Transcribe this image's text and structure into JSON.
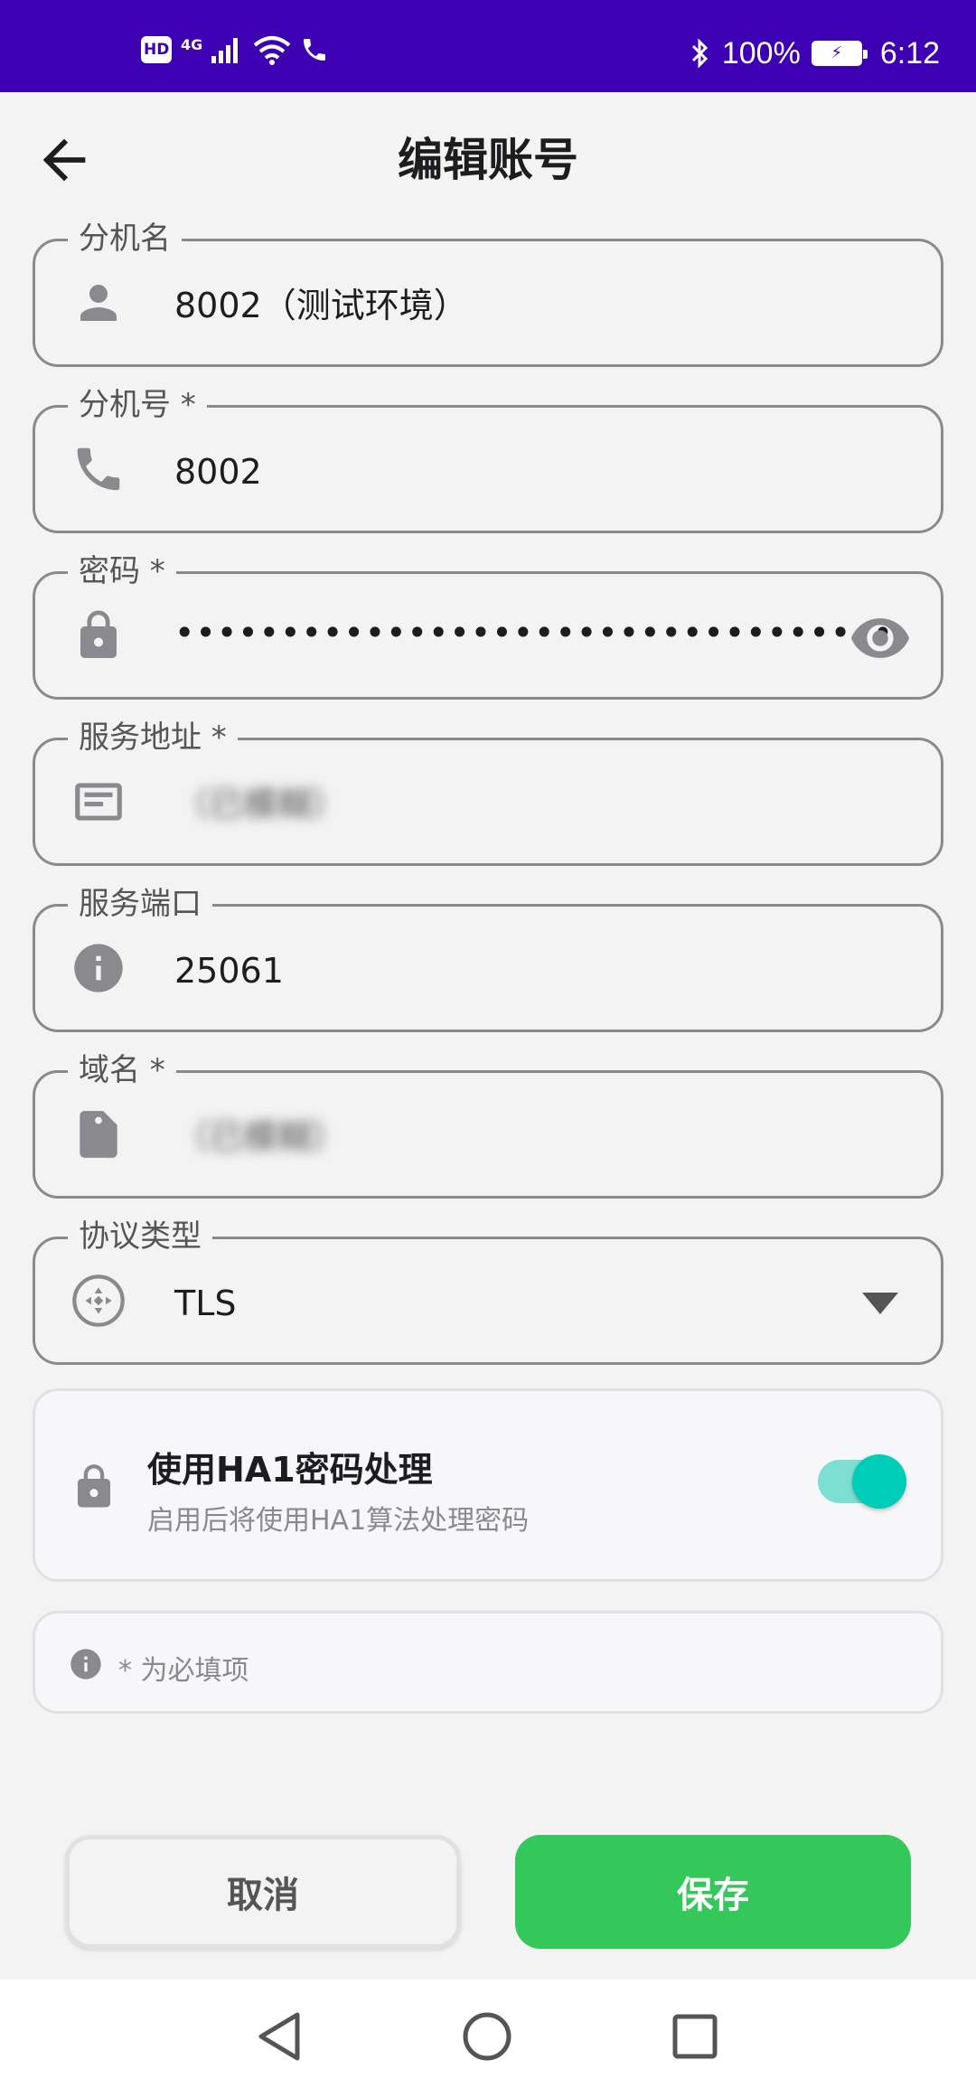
{
  "status_bar": {
    "hd": "HD",
    "network": "4G",
    "battery_percent": "100%",
    "time": "6:12"
  },
  "header": {
    "title": "编辑账号"
  },
  "fields": {
    "extension_name": {
      "label": "分机名",
      "value": "8002（测试环境）"
    },
    "extension_number": {
      "label": "分机号 *",
      "value": "8002"
    },
    "password": {
      "label": "密码 *",
      "value": "••••••••••••••••••••••••••••••••••"
    },
    "server_address": {
      "label": "服务地址 *",
      "value": "（已模糊）"
    },
    "server_port": {
      "label": "服务端口",
      "value": "25061"
    },
    "domain": {
      "label": "域名 *",
      "value": "（已模糊）"
    },
    "protocol": {
      "label": "协议类型",
      "value": "TLS"
    }
  },
  "ha1": {
    "title": "使用HA1密码处理",
    "subtitle": "启用后将使用HA1算法处理密码",
    "enabled": true
  },
  "required_note": "* 为必填项",
  "buttons": {
    "cancel": "取消",
    "save": "保存"
  },
  "colors": {
    "status_bar": "#3d00b2",
    "save_button": "#34c759",
    "toggle_on": "#00cdb8"
  }
}
